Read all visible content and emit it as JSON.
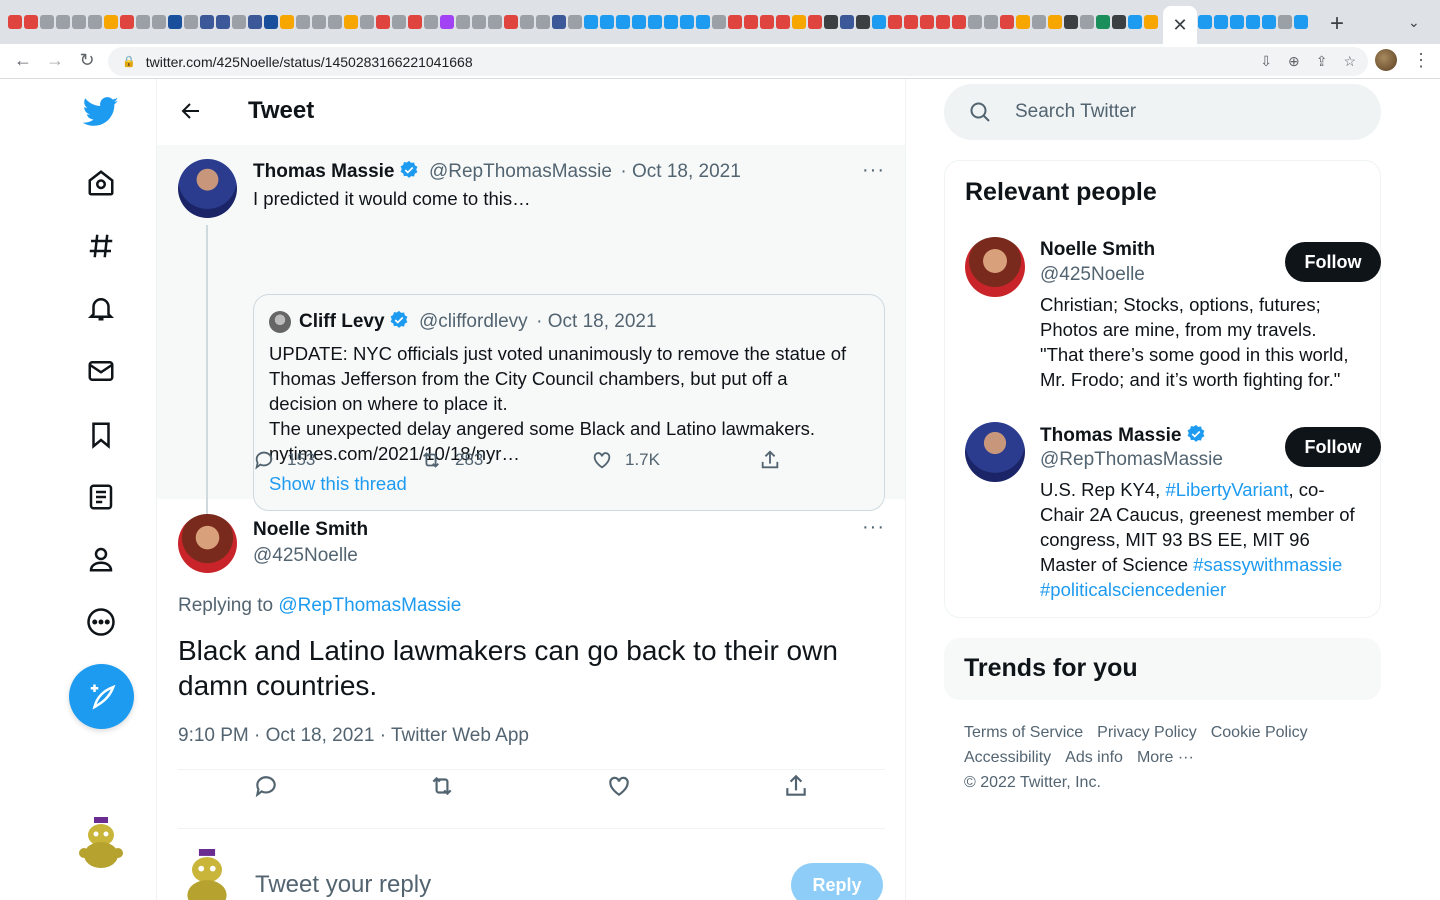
{
  "browser": {
    "url": "twitter.com/425Noelle/status/1450283166221041668",
    "tab_close": "✕"
  },
  "header": {
    "title": "Tweet"
  },
  "parent_tweet": {
    "name": "Thomas Massie",
    "handle": "@RepThomasMassie",
    "date": "· Oct 18, 2021",
    "text": "I predicted it would come to this…",
    "quote": {
      "name": "Cliff Levy",
      "handle": "@cliffordlevy",
      "date": "· Oct 18, 2021",
      "line1": "UPDATE: NYC officials just voted unanimously to remove the statue of",
      "line2": "Thomas Jefferson from the City Council chambers, but put off a",
      "line3": "decision on where to place it.",
      "line4": "The unexpected delay angered some Black and Latino lawmakers.",
      "line5": "nytimes.com/2021/10/18/nyr…",
      "show_thread": "Show this thread"
    },
    "replies": "153",
    "retweets": "283",
    "likes": "1.7K"
  },
  "focus_tweet": {
    "name": "Noelle Smith",
    "handle": "@425Noelle",
    "replying_label": "Replying to",
    "replying_handle": "@RepThomasMassie",
    "text_line1": "Black and Latino lawmakers can go back to their own",
    "text_line2": "damn countries.",
    "meta": "9:10 PM · Oct 18, 2021 · Twitter Web App"
  },
  "reply_box": {
    "placeholder": "Tweet your reply",
    "button": "Reply"
  },
  "search": {
    "placeholder": "Search Twitter"
  },
  "relevant_people": {
    "title": "Relevant people",
    "people": [
      {
        "name": "Noelle Smith",
        "handle": "@425Noelle",
        "follow": "Follow",
        "bio1": "Christian; Stocks, options, futures;",
        "bio2": "Photos are mine, from my travels.",
        "bio3": "\"That there’s some good in this world,",
        "bio4": "Mr. Frodo; and it’s worth fighting for.\""
      },
      {
        "name": "Thomas Massie",
        "handle": "@RepThomasMassie",
        "follow": "Follow",
        "bio1a": "U.S. Rep KY4, ",
        "bio1b": "#LibertyVariant",
        "bio1c": ", co-",
        "bio2": "Chair 2A Caucus, greenest member of",
        "bio3": "congress, MIT 93 BS EE, MIT 96",
        "bio4a": "Master of Science ",
        "bio4b": "#sassywithmassie",
        "bio5": "#politicalsciencedenier"
      }
    ]
  },
  "trends": {
    "title": "Trends for you"
  },
  "footer": {
    "terms": "Terms of Service",
    "privacy": "Privacy Policy",
    "cookie": "Cookie Policy",
    "accessibility": "Accessibility",
    "ads": "Ads info",
    "more": "More ···",
    "copyright": "© 2022 Twitter, Inc."
  },
  "colors": {
    "accent": "#1d9bf0",
    "text": "#0f1419",
    "muted": "#536471"
  }
}
